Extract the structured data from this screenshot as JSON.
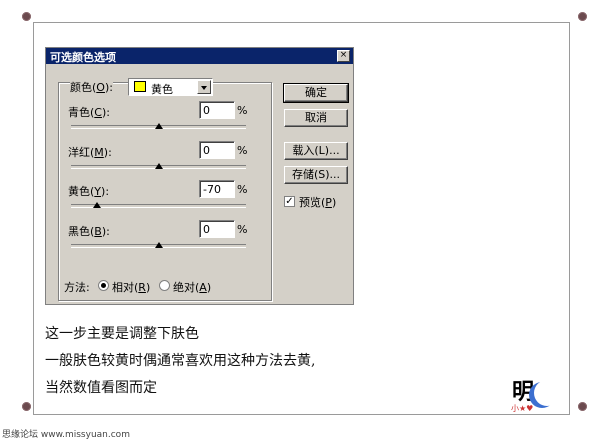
{
  "dialog": {
    "title": "可选颜色选项",
    "close": "×",
    "colors_label": "颜色(",
    "colors_key": "O",
    "colors_end": "):",
    "selected_color": "黄色",
    "swatch_color": "#ffff00",
    "rows": [
      {
        "pre": "青色(",
        "key": "C",
        "post": "):",
        "value": "0",
        "unit": "%",
        "slider_pct": 0.5
      },
      {
        "pre": "洋红(",
        "key": "M",
        "post": "):",
        "value": "0",
        "unit": "%",
        "slider_pct": 0.5
      },
      {
        "pre": "黄色(",
        "key": "Y",
        "post": "):",
        "value": "-70",
        "unit": "%",
        "slider_pct": 0.15
      },
      {
        "pre": "黑色(",
        "key": "B",
        "post": "):",
        "value": "0",
        "unit": "%",
        "slider_pct": 0.5
      }
    ],
    "buttons": {
      "ok": "确定",
      "cancel": "取消",
      "load": "载入(L)...",
      "save": "存储(S)..."
    },
    "preview": {
      "label_pre": "预览(",
      "key": "P",
      "label_post": ")",
      "checked": "✓"
    },
    "method": {
      "label": "方法:",
      "relative_pre": "相对(",
      "relative_key": "R",
      "relative_post": ")",
      "absolute_pre": "绝对(",
      "absolute_key": "A",
      "absolute_post": ")"
    }
  },
  "caption": {
    "line1": "这一步主要是调整下肤色",
    "line2": "一般肤色较黄时偶通常喜欢用这种方法去黄,",
    "line3": "当然数值看图而定"
  },
  "logo": {
    "char": "明",
    "sub": "小★♥"
  },
  "footer": {
    "text": "思缘论坛  www.missyuan.com"
  }
}
